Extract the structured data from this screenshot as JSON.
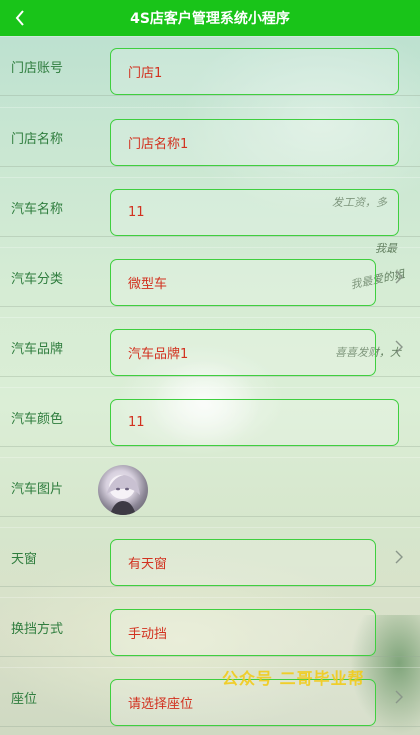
{
  "navbar": {
    "title": "4S店客户管理系统小程序",
    "back_icon": "chevron-left-icon",
    "background": "#19c419"
  },
  "form": {
    "rows": [
      {
        "label": "门店账号",
        "value": "门店1"
      },
      {
        "label": "门店名称",
        "value": "门店名称1"
      },
      {
        "label": "汽车名称",
        "value": "11"
      },
      {
        "label": "汽车分类",
        "value": "微型车"
      },
      {
        "label": "汽车品牌",
        "value": "汽车品牌1"
      },
      {
        "label": "汽车颜色",
        "value": "11"
      },
      {
        "label": "汽车图片"
      },
      {
        "label": "天窗",
        "value": "有天窗"
      },
      {
        "label": "换挡方式",
        "value": "手动挡"
      },
      {
        "label": "座位",
        "placeholder": "请选择座位"
      }
    ]
  },
  "watermark": "公众号 二哥毕业帮",
  "handwriting": {
    "a": "发工资，多",
    "b": "我最",
    "c": "我最爱的姐",
    "d": "喜喜发财，大"
  },
  "colors": {
    "accent": "#19c419",
    "label": "#2f7d3e",
    "value": "#d2311f",
    "border": "#3fcf3f"
  }
}
